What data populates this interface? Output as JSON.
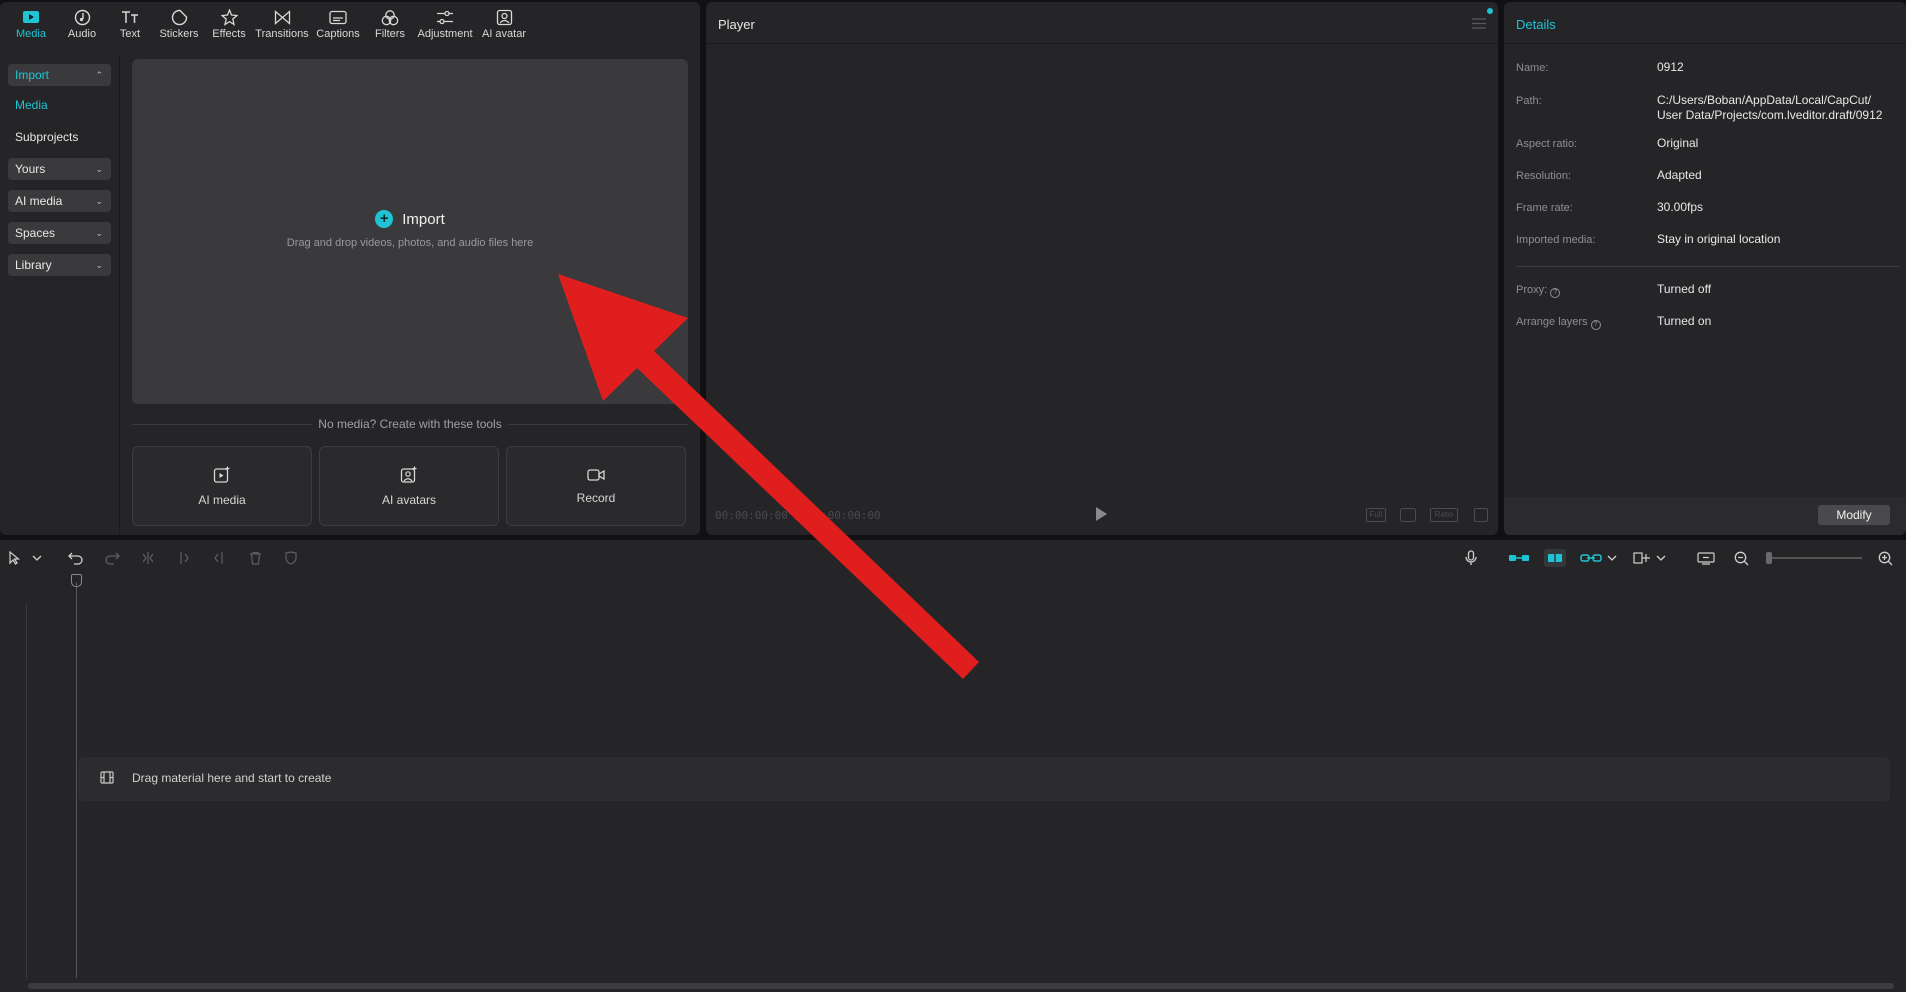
{
  "toolbar": {
    "tabs": [
      {
        "label": "Media",
        "icon": "media-icon",
        "active": true
      },
      {
        "label": "Audio",
        "icon": "audio-icon"
      },
      {
        "label": "Text",
        "icon": "text-icon"
      },
      {
        "label": "Stickers",
        "icon": "stickers-icon"
      },
      {
        "label": "Effects",
        "icon": "effects-icon"
      },
      {
        "label": "Transitions",
        "icon": "transitions-icon"
      },
      {
        "label": "Captions",
        "icon": "captions-icon"
      },
      {
        "label": "Filters",
        "icon": "filters-icon"
      },
      {
        "label": "Adjustment",
        "icon": "adjustment-icon"
      },
      {
        "label": "AI avatar",
        "icon": "ai-avatar-icon"
      }
    ]
  },
  "sidebar": {
    "import": "Import",
    "media": "Media",
    "subprojects": "Subprojects",
    "yours": "Yours",
    "ai_media": "AI media",
    "spaces": "Spaces",
    "library": "Library"
  },
  "dropzone": {
    "title": "Import",
    "subtitle": "Drag and drop videos, photos, and audio files here"
  },
  "tools": {
    "divider": "No media? Create with these tools",
    "ai_media": "AI media",
    "ai_avatars": "AI avatars",
    "record": "Record"
  },
  "player": {
    "title": "Player",
    "timecode": "00:00:00:00 / 00:00:00:00",
    "full": "Full",
    "ratio": "Ratio"
  },
  "details": {
    "title": "Details",
    "name_label": "Name:",
    "name_value": "0912",
    "path_label": "Path:",
    "path_value_1": "C:/Users/Boban/AppData/Local/CapCut/",
    "path_value_2": "User Data/Projects/com.lveditor.draft/0912",
    "aspect_label": "Aspect ratio:",
    "aspect_value": "Original",
    "resolution_label": "Resolution:",
    "resolution_value": "Adapted",
    "framerate_label": "Frame rate:",
    "framerate_value": "30.00fps",
    "imported_label": "Imported media:",
    "imported_value": "Stay in original location",
    "proxy_label": "Proxy:",
    "proxy_value": "Turned off",
    "arrange_label": "Arrange layers",
    "arrange_value": "Turned on",
    "modify": "Modify"
  },
  "timeline": {
    "drop_text": "Drag material here and start to create"
  },
  "colors": {
    "accent": "#1fc4d4",
    "arrow": "#e01e1e",
    "panel": "#252527"
  }
}
